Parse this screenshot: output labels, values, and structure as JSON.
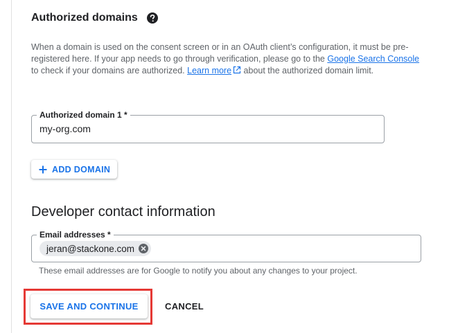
{
  "authorized_domains": {
    "heading": "Authorized domains",
    "help_icon": "help-circle-icon",
    "description_part1": "When a domain is used on the consent screen or in an OAuth client’s configuration, it must be pre-registered here. If your app needs to go through verification, please go to the ",
    "search_console_link": "Google Search Console",
    "description_part2": " to check if your domains are authorized. ",
    "learn_more_link": "Learn more",
    "description_part3": " about the authorized domain limit.",
    "domain_field": {
      "label": "Authorized domain 1 *",
      "value": "my-org.com"
    },
    "add_domain_label": "ADD DOMAIN"
  },
  "developer_contact": {
    "heading": "Developer contact information",
    "email_field": {
      "label": "Email addresses *",
      "chips": [
        "jeran@stackone.com"
      ]
    },
    "helper_text": "These email addresses are for Google to notify you about any changes to your project."
  },
  "actions": {
    "save_label": "SAVE AND CONTINUE",
    "cancel_label": "CANCEL"
  },
  "colors": {
    "accent": "#1a73e8",
    "highlight": "#e53935",
    "chip_bg": "#e8eaed"
  }
}
